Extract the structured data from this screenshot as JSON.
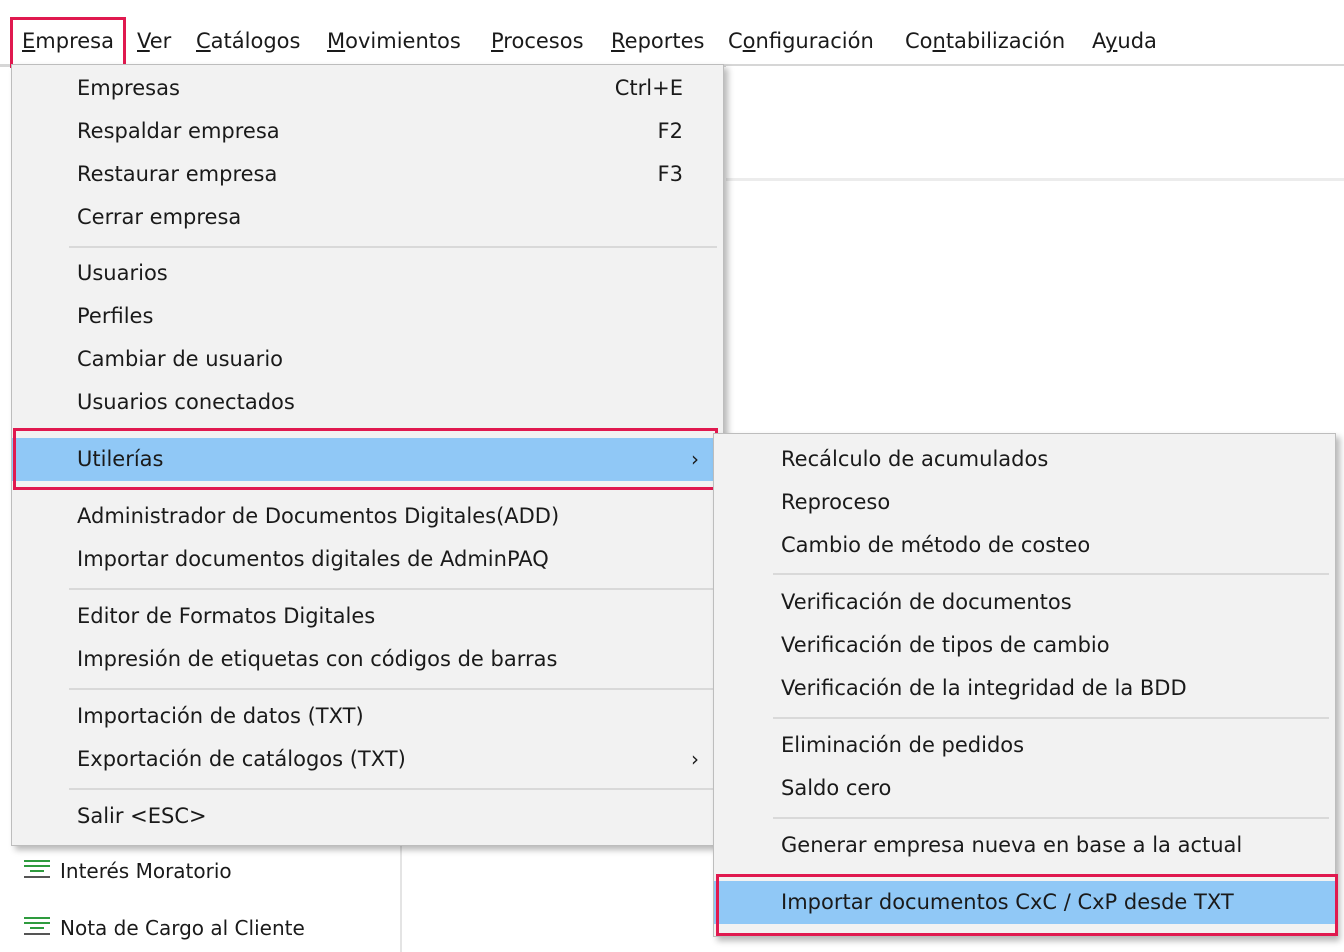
{
  "menubar": {
    "items": [
      {
        "key": "E",
        "rest": "mpresa"
      },
      {
        "key": "V",
        "rest": "er"
      },
      {
        "key": "C",
        "rest": "atálogos"
      },
      {
        "key": "M",
        "rest": "ovimientos"
      },
      {
        "key": "P",
        "rest": "rocesos"
      },
      {
        "key": "R",
        "rest": "eportes"
      },
      {
        "pre": "C",
        "key": "o",
        "rest": "nfiguración"
      },
      {
        "pre": "Co",
        "key": "n",
        "rest": "tabilización"
      },
      {
        "pre": "A",
        "key": "y",
        "rest": "uda"
      }
    ]
  },
  "empresa_menu": {
    "empresas": {
      "label": "Empresas",
      "shortcut": "Ctrl+E"
    },
    "respaldar": {
      "label": "Respaldar empresa",
      "shortcut": "F2"
    },
    "restaurar": {
      "label": "Restaurar empresa",
      "shortcut": "F3"
    },
    "cerrar": {
      "label": "Cerrar empresa"
    },
    "usuarios": {
      "label": "Usuarios"
    },
    "perfiles": {
      "label": "Perfiles"
    },
    "cambiar_usuario": {
      "label": "Cambiar de usuario"
    },
    "usuarios_conectados": {
      "label": "Usuarios conectados"
    },
    "utilerias": {
      "label": "Utilerías",
      "arrow": "›"
    },
    "add": {
      "label": "Administrador de Documentos Digitales(ADD)"
    },
    "importar_adminpaq": {
      "label": "Importar documentos digitales de AdminPAQ"
    },
    "editor_formatos": {
      "label": "Editor de Formatos Digitales"
    },
    "impresion_etiquetas": {
      "label": "Impresión de etiquetas con códigos de barras"
    },
    "importacion_datos": {
      "label": "Importación de datos (TXT)"
    },
    "exportacion_catalogos": {
      "label": "Exportación de catálogos (TXT)",
      "arrow": "›"
    },
    "salir": {
      "label": "Salir <ESC>"
    }
  },
  "utilerias_menu": {
    "recalculo": {
      "label": "Recálculo de acumulados"
    },
    "reproceso": {
      "label": "Reproceso"
    },
    "cambio_costeo": {
      "label": "Cambio de método de costeo"
    },
    "verif_documentos": {
      "label": "Verificación de documentos"
    },
    "verif_tipos_cambio": {
      "label": "Verificación de tipos de cambio"
    },
    "verif_integridad": {
      "label": "Verificación de la integridad de la BDD"
    },
    "eliminacion_pedidos": {
      "label": "Eliminación de pedidos"
    },
    "saldo_cero": {
      "label": "Saldo cero"
    },
    "generar_empresa": {
      "label": "Generar empresa nueva en base a la actual"
    },
    "importar_cxc_cxp": {
      "label": "Importar documentos CxC / CxP desde TXT"
    }
  },
  "background_list": {
    "items": [
      {
        "label": "Interés Moratorio",
        "icon": "list-lines-icon"
      },
      {
        "label": "Nota de Cargo al Cliente",
        "icon": "list-lines-icon"
      }
    ]
  },
  "colors": {
    "highlight_box": "#e0194f",
    "selected_item": "#90c8f6",
    "menu_background": "#f2f2f2",
    "icon_green": "#2e9b3e"
  }
}
